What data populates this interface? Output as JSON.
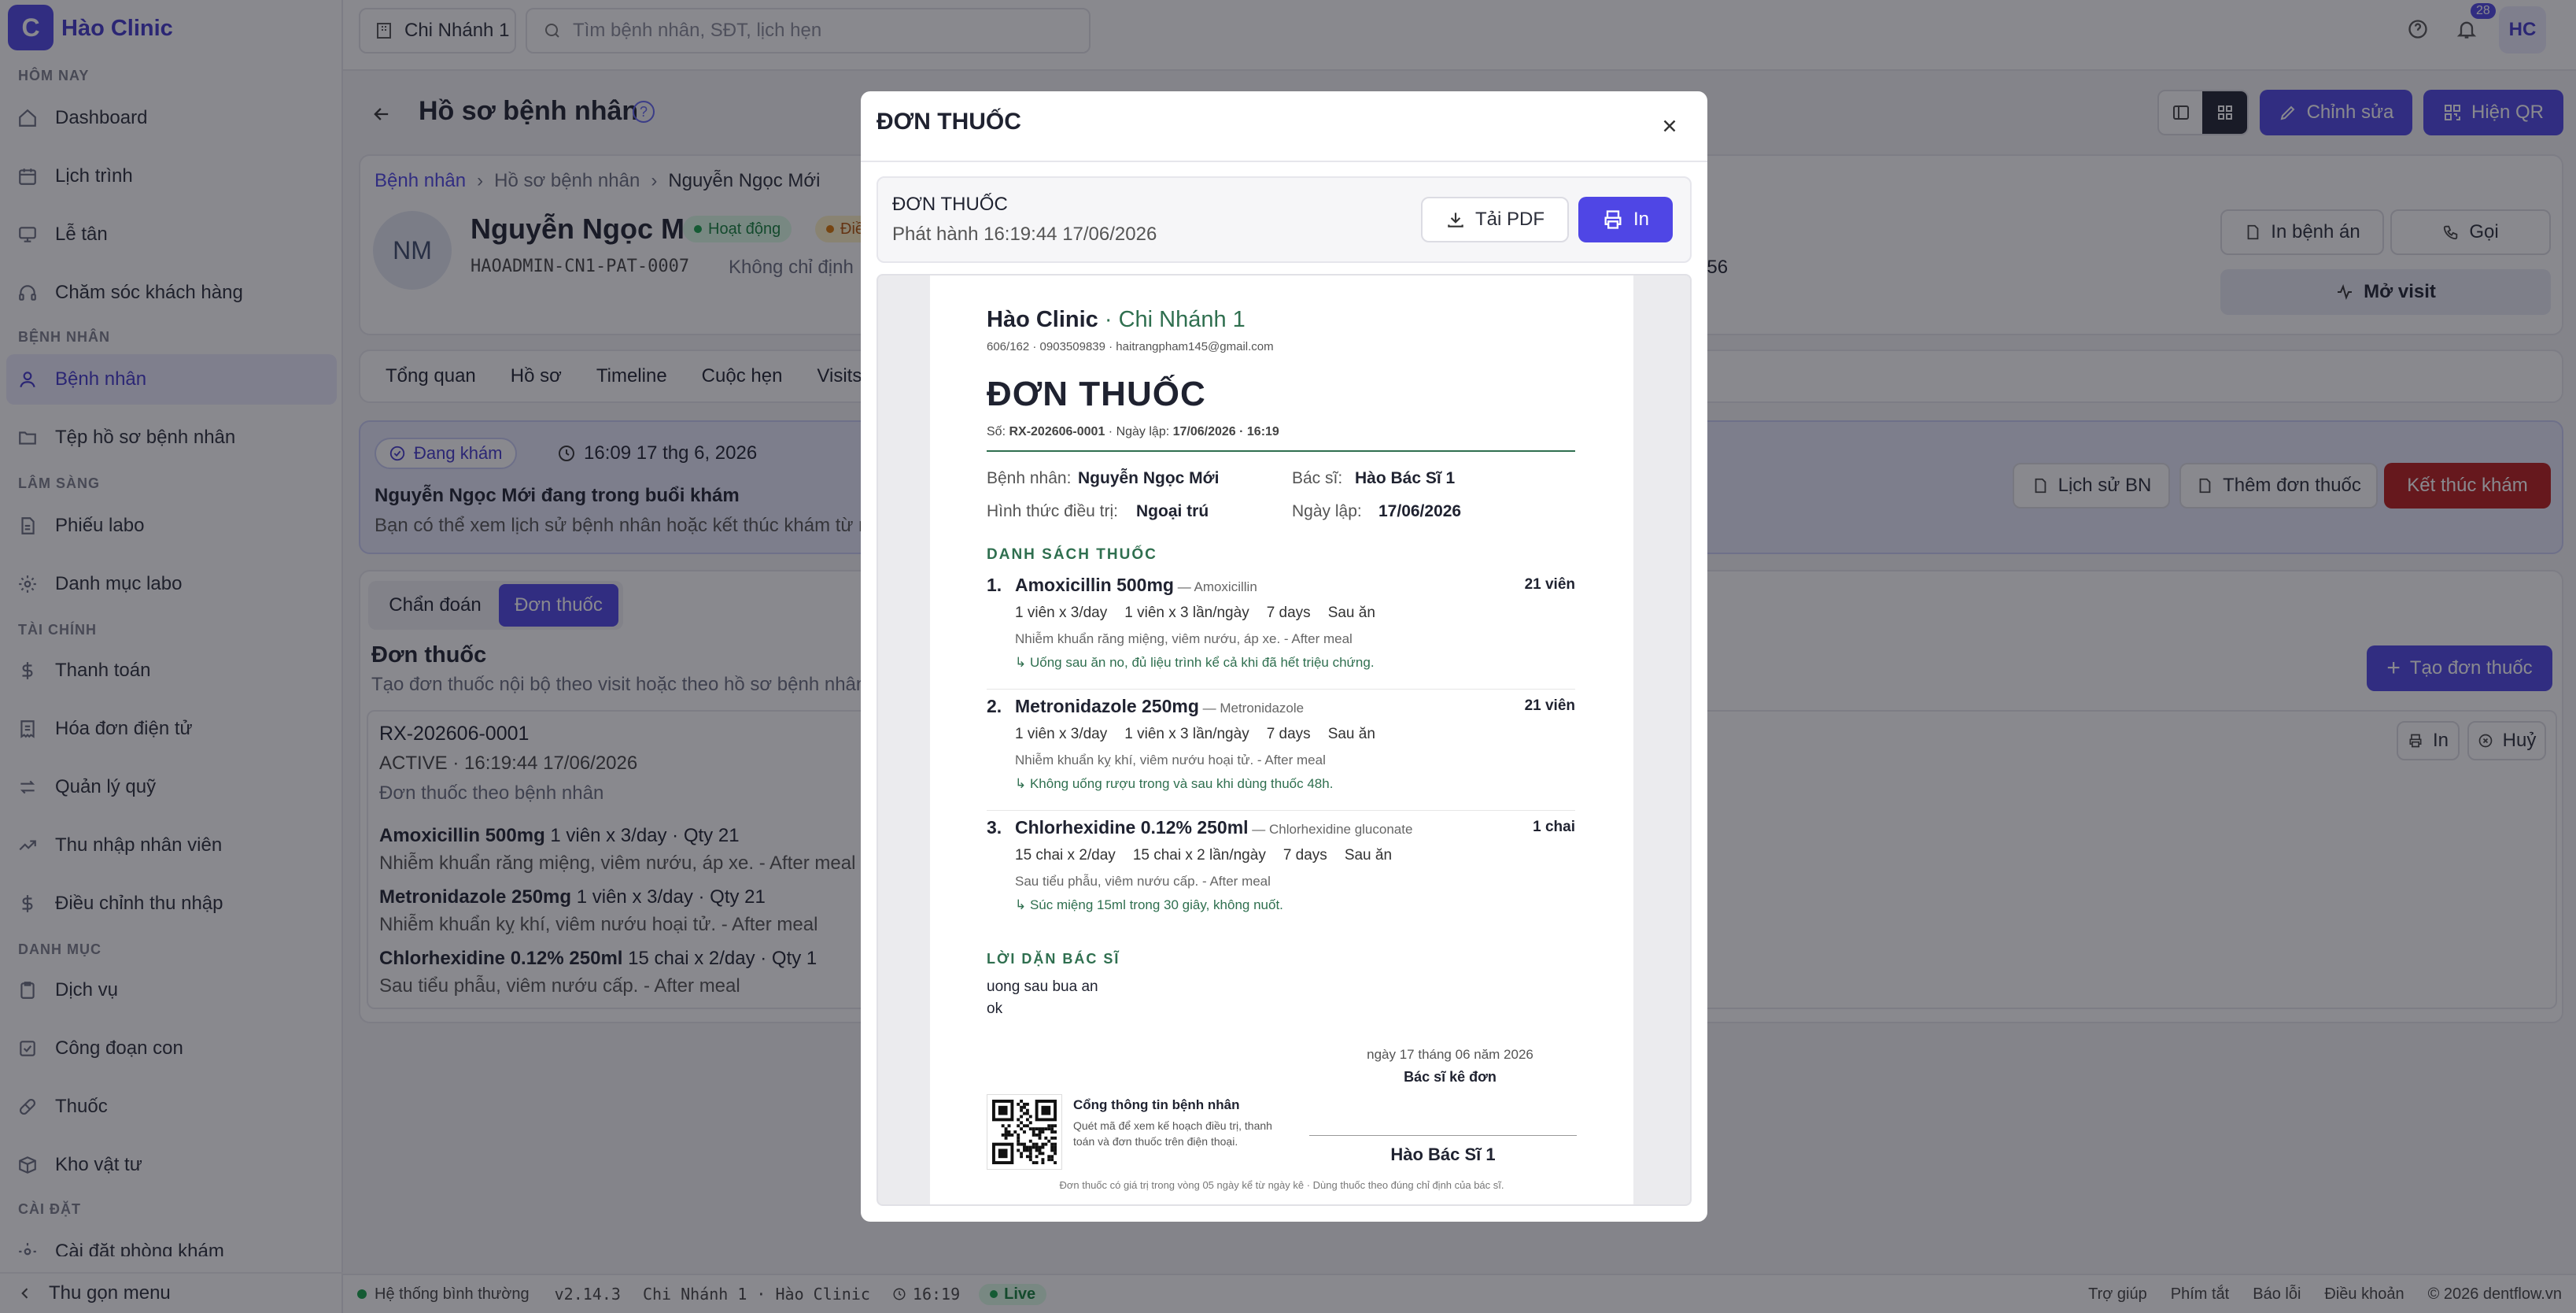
{
  "sidebar": {
    "brand_letter": "C",
    "brand": "Hào Clinic",
    "sections": {
      "today": "HÔM NAY",
      "patients": "BỆNH NHÂN",
      "clinical": "LÂM SÀNG",
      "finance": "TÀI CHÍNH",
      "catalog": "DANH MỤC",
      "settings": "CÀI ĐẶT"
    },
    "items": {
      "dashboard": "Dashboard",
      "schedule": "Lịch trình",
      "reception": "Lễ tân",
      "customer_care": "Chăm sóc khách hàng",
      "patients": "Bệnh nhân",
      "patient_files": "Tệp hồ sơ bệnh nhân",
      "lab_orders": "Phiếu labo",
      "lab_catalog": "Danh mục labo",
      "payments": "Thanh toán",
      "e_invoices": "Hóa đơn điện tử",
      "funds": "Quản lý quỹ",
      "staff_income": "Thu nhập nhân viên",
      "income_adjust": "Điều chỉnh thu nhập",
      "services": "Dịch vụ",
      "sub_procedures": "Công đoạn con",
      "drugs": "Thuốc",
      "supplies": "Kho vật tư",
      "settings_partial": "Cài đặt phòng khám"
    },
    "collapse": "Thu gọn menu"
  },
  "topbar": {
    "branch": "Chi Nhánh 1",
    "search_placeholder": "Tìm bệnh nhân, SĐT, lịch hẹn",
    "notif_count": "28",
    "avatar": "HC"
  },
  "page": {
    "title": "Hồ sơ bệnh nhân",
    "edit": "Chỉnh sửa",
    "show_qr": "Hiện QR",
    "breadcrumb": [
      "Bệnh nhân",
      "Hồ sơ bệnh nhân",
      "Nguyễn Ngọc Mới"
    ],
    "patient_initials": "NM",
    "patient_name": "Nguyễn Ngọc Mới",
    "status_active": "Hoạt động",
    "status_second": "Điề",
    "patient_code": "HAOADMIN-CN1-PAT-0007",
    "not_assigned": "Không chỉ định",
    "partial_value": "056",
    "print_record": "In bệnh án",
    "call": "Gọi",
    "open_visit": "Mở visit",
    "tabs": [
      "Tổng quan",
      "Hồ sơ",
      "Timeline",
      "Cuộc hẹn",
      "Visits"
    ],
    "visit_status": "Đang khám",
    "visit_time": "16:09 17 thg 6, 2026",
    "visit_heading": "Nguyễn Ngọc Mới đang trong buổi khám",
    "visit_desc": "Bạn có thể xem lịch sử bệnh nhân hoặc kết thúc khám từ n",
    "history": "Lịch sử BN",
    "add_rx": "Thêm đơn thuốc",
    "end_visit": "Kết thúc khám",
    "subtabs": [
      "Chẩn đoán",
      "Đơn thuốc"
    ],
    "rx_section_title": "Đơn thuốc",
    "rx_section_desc": "Tạo đơn thuốc nội bộ theo visit hoặc theo hồ sơ bệnh nhân",
    "create_rx": "Tạo đơn thuốc",
    "rx_print": "In",
    "rx_cancel": "Huỷ",
    "rx_code": "RX-202606-0001",
    "rx_meta": "ACTIVE · 16:19:44 17/06/2026",
    "rx_kind": "Đơn thuốc theo bệnh nhân",
    "rx_items": [
      {
        "name": "Amoxicillin 500mg",
        "detail": " 1 viên x 3/day · Qty 21",
        "note": "Nhiễm khuẩn răng miệng, viêm nướu, áp xe. - After meal"
      },
      {
        "name": "Metronidazole 250mg",
        "detail": " 1 viên x 3/day · Qty 21",
        "note": "Nhiễm khuẩn kỵ khí, viêm nướu hoại tử. - After meal"
      },
      {
        "name": "Chlorhexidine 0.12% 250ml",
        "detail": " 15 chai x 2/day · Qty 1",
        "note": "Sau tiểu phẫu, viêm nướu cấp. - After meal"
      }
    ]
  },
  "footer": {
    "status": "Hệ thống bình thường",
    "version": "v2.14.3",
    "branch_clinic": "Chi Nhánh 1 · Hào Clinic",
    "time": "16:19",
    "live": "Live",
    "help": "Trợ giúp",
    "shortcuts": "Phím tắt",
    "report": "Báo lỗi",
    "terms": "Điều khoản",
    "copyright": "© 2026 dentflow.vn"
  },
  "modal": {
    "title": "ĐƠN THUỐC",
    "doc_title": "ĐƠN THUỐC",
    "issued": "Phát hành 16:19:44 17/06/2026",
    "download_pdf": "Tải PDF",
    "print": "In",
    "rx": {
      "clinic": "Hào Clinic",
      "branch": " · Chi Nhánh 1",
      "contact": "606/162 · 0903509839 · haitrangpham145@gmail.com",
      "heading": "ĐƠN THUỐC",
      "number_label": "Số: ",
      "number": "RX-202606-0001",
      "date_label": " · Ngày lập: ",
      "date": "17/06/2026 · 16:19",
      "patient_label": "Bệnh nhân:",
      "patient": "Nguyễn Ngọc Mới",
      "doctor_label": "Bác sĩ:",
      "doctor": "Hào Bác Sĩ 1",
      "mode_label": "Hình thức điều trị:",
      "mode": "Ngoại trú",
      "created_label": "Ngày lập:",
      "created": "17/06/2026",
      "list_title": "DANH SÁCH THUỐC",
      "meds": [
        {
          "no": "1.",
          "name": "Amoxicillin 500mg",
          "generic": " — Amoxicillin",
          "qty": "21 viên",
          "dose": "1 viên x 3/day",
          "freq": "1 viên x 3 lần/ngày",
          "days": "7 days",
          "when": "Sau ăn",
          "indication": "Nhiễm khuẩn răng miệng, viêm nướu, áp xe. - After meal",
          "instruction": "↳ Uống sau ăn no, đủ liệu trình kể cả khi đã hết triệu chứng."
        },
        {
          "no": "2.",
          "name": "Metronidazole 250mg",
          "generic": " — Metronidazole",
          "qty": "21 viên",
          "dose": "1 viên x 3/day",
          "freq": "1 viên x 3 lần/ngày",
          "days": "7 days",
          "when": "Sau ăn",
          "indication": "Nhiễm khuẩn kỵ khí, viêm nướu hoại tử. - After meal",
          "instruction": "↳ Không uống rượu trong và sau khi dùng thuốc 48h."
        },
        {
          "no": "3.",
          "name": "Chlorhexidine 0.12% 250ml",
          "generic": " — Chlorhexidine gluconate",
          "qty": "1 chai",
          "dose": "15 chai x 2/day",
          "freq": "15 chai x 2 lần/ngày",
          "days": "7 days",
          "when": "Sau ăn",
          "indication": "Sau tiểu phẫu, viêm nướu cấp. - After meal",
          "instruction": "↳ Súc miệng 15ml trong 30 giây, không nuốt."
        }
      ],
      "advice_title": "LỜI DẶN BÁC SĨ",
      "advice_lines": [
        "uong sau bua an",
        "ok"
      ],
      "sign_date": "ngày 17 tháng 06 năm 2026",
      "sign_role": "Bác sĩ kê đơn",
      "portal_title": "Cổng thông tin bệnh nhân",
      "portal_desc": "Quét mã để xem kế hoạch điều trị, thanh toán và đơn thuốc trên điện thoại.",
      "signer": "Hào Bác Sĩ 1",
      "validity": "Đơn thuốc có giá trị trong vòng 05 ngày kể từ ngày kê · Dùng thuốc theo đúng chỉ định của bác sĩ."
    }
  },
  "colors": {
    "primary": "#4f46e5",
    "danger": "#b91c1c",
    "success": "#16a34a",
    "rx_green": "#2f6f4f"
  }
}
